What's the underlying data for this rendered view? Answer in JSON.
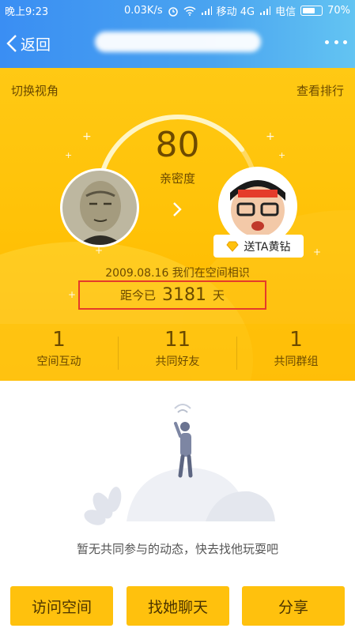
{
  "status_bar": {
    "time": "晚上9:23",
    "speed": "0.03K/s",
    "carrier1": "移动 4G",
    "carrier2": "电信",
    "battery": "70%"
  },
  "nav": {
    "back_label": "返回"
  },
  "header": {
    "switch_view": "切换视角",
    "ranking": "查看排行"
  },
  "intimacy": {
    "score": "80",
    "label": "亲密度",
    "score_fraction": 0.8
  },
  "gift": {
    "label": "送TA黄钻"
  },
  "meet": {
    "text": "2009.08.16 我们在空间相识",
    "days_prefix": "距今已",
    "days": "3181",
    "days_unit": "天"
  },
  "stats": [
    {
      "value": "1",
      "label": "空间互动"
    },
    {
      "value": "11",
      "label": "共同好友"
    },
    {
      "value": "1",
      "label": "共同群组"
    }
  ],
  "empty_state": {
    "text": "暂无共同参与的动态，快去找他玩耍吧"
  },
  "actions": {
    "visit": "访问空间",
    "chat": "找她聊天",
    "share": "分享"
  },
  "colors": {
    "nav_blue": "#3a8ef3",
    "hero_yellow": "#ffc10d",
    "highlight_red": "#e53b2a"
  }
}
